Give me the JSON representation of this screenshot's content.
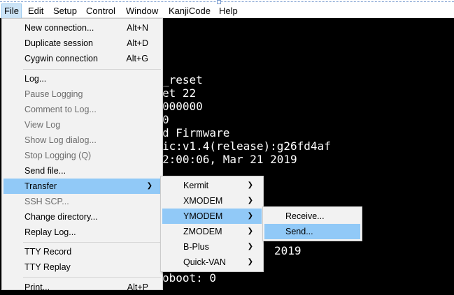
{
  "menubar": {
    "items": [
      "File",
      "Edit",
      "Setup",
      "Control",
      "Window",
      "KanjiCode",
      "Help"
    ]
  },
  "terminal": {
    "lines": [
      "_reset",
      "et 22",
      "000000",
      "0",
      "d Firmware",
      "ic:v1.4(release):g26fd4af",
      "2:00:06, Mar 21 2019",
      "2019",
      "oboot: 0"
    ]
  },
  "file_menu": {
    "items": [
      {
        "label": "New connection...",
        "shortcut": "Alt+N",
        "disabled": false
      },
      {
        "label": "Duplicate session",
        "shortcut": "Alt+D",
        "disabled": false
      },
      {
        "label": "Cygwin connection",
        "shortcut": "Alt+G",
        "disabled": false
      },
      {
        "label": "Log...",
        "shortcut": "",
        "disabled": false
      },
      {
        "label": "Pause Logging",
        "shortcut": "",
        "disabled": true
      },
      {
        "label": "Comment to Log...",
        "shortcut": "",
        "disabled": true
      },
      {
        "label": "View Log",
        "shortcut": "",
        "disabled": true
      },
      {
        "label": "Show Log dialog...",
        "shortcut": "",
        "disabled": true
      },
      {
        "label": "Stop Logging (Q)",
        "shortcut": "",
        "disabled": true
      },
      {
        "label": "Send file...",
        "shortcut": "",
        "disabled": false
      },
      {
        "label": "Transfer",
        "shortcut": "",
        "disabled": false
      },
      {
        "label": "SSH SCP...",
        "shortcut": "",
        "disabled": true
      },
      {
        "label": "Change directory...",
        "shortcut": "",
        "disabled": false
      },
      {
        "label": "Replay Log...",
        "shortcut": "",
        "disabled": false
      },
      {
        "label": "TTY Record",
        "shortcut": "",
        "disabled": false
      },
      {
        "label": "TTY Replay",
        "shortcut": "",
        "disabled": false
      },
      {
        "label": "Print...",
        "shortcut": "Alt+P",
        "disabled": false
      }
    ]
  },
  "transfer_menu": {
    "items": [
      "Kermit",
      "XMODEM",
      "YMODEM",
      "ZMODEM",
      "B-Plus",
      "Quick-VAN"
    ]
  },
  "ymodem_menu": {
    "items": [
      "Receive...",
      "Send..."
    ]
  },
  "colors": {
    "highlight": "#91c9f7",
    "menu_bg": "#f2f2f2",
    "terminal_bg": "#000000"
  }
}
